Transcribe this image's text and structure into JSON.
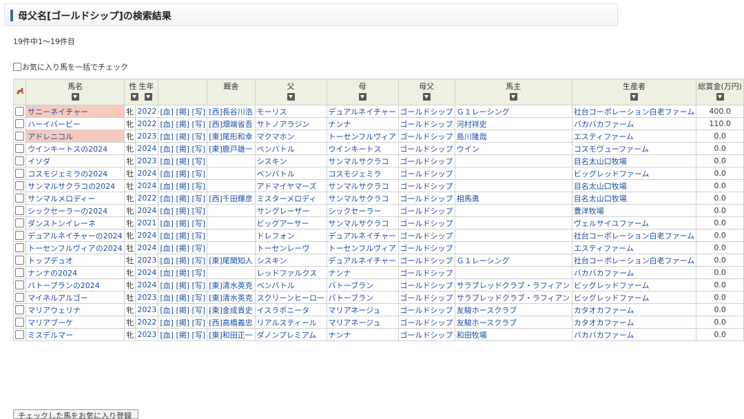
{
  "page": {
    "title": "母父名[ゴールドシップ]の検索結果",
    "count_text": "19件中1〜19件目",
    "check_all_label": "お気に入り馬を一括でチェック",
    "bottom_button_label": "チェックした馬をお気に入り登録",
    "accent_color": "#2c6fb6",
    "highlight_color": "#f5cbbd"
  },
  "table": {
    "headers": {
      "icon": "horse-icon",
      "horse_name": "馬名",
      "sex": "性",
      "birth_year": "生年",
      "stable": "厩舎",
      "sire": "父",
      "dam": "母",
      "dam_sire": "母父",
      "owner": "馬主",
      "breeder": "生産者",
      "earnings": "総賞金(万円)"
    },
    "link_labels": [
      "[血]",
      "[掲]",
      "[写]"
    ],
    "rows": [
      {
        "horse": "サニーネイチャー",
        "hl": true,
        "sex": "牝",
        "year": "2022",
        "stable": "[西]長谷川浩",
        "sire": "モーリス",
        "dam": "デュアルネイチャー",
        "dam_sire": "ゴールドシップ",
        "owner": "Ｇ１レーシング",
        "breeder": "社台コーポレーション白老ファーム",
        "earnings": "400.0"
      },
      {
        "horse": "ハーイバービー",
        "hl": false,
        "sex": "牝",
        "year": "2022",
        "stable": "[西]畑端省吾",
        "sire": "サトノアラジン",
        "dam": "ナンナ",
        "dam_sire": "ゴールドシップ",
        "owner": "河村祥史",
        "breeder": "バカバカファーム",
        "earnings": "110.0"
      },
      {
        "horse": "アドレニコル",
        "hl": true,
        "sex": "牝",
        "year": "2023",
        "stable": "[東]尾形和幸",
        "sire": "マクマホン",
        "dam": "トーセンフルヴィア",
        "dam_sire": "ゴールドシップ",
        "owner": "島川隆哉",
        "breeder": "エスティファーム",
        "earnings": "0.0"
      },
      {
        "horse": "ウインキートスの2024",
        "hl": false,
        "sex": "牝",
        "year": "2024",
        "stable": "[東]鹿戸雄一",
        "sire": "ベンバトル",
        "dam": "ウインキートス",
        "dam_sire": "ゴールドシップ",
        "owner": "ウイン",
        "breeder": "コスモヴューファーム",
        "earnings": "0.0"
      },
      {
        "horse": "イソダ",
        "hl": false,
        "sex": "牝",
        "year": "2023",
        "stable": "",
        "sire": "シスキン",
        "dam": "サンマルサクラコ",
        "dam_sire": "ゴールドシップ",
        "owner": "",
        "breeder": "目名太山口牧場",
        "earnings": "0.0"
      },
      {
        "horse": "コスモジェミラの2024",
        "hl": false,
        "sex": "牡",
        "year": "2024",
        "stable": "",
        "sire": "ベンバトル",
        "dam": "コスモジェミラ",
        "dam_sire": "ゴールドシップ",
        "owner": "",
        "breeder": "ビッグレッドファーム",
        "earnings": "0.0"
      },
      {
        "horse": "サンマルサクラコの2024",
        "hl": false,
        "sex": "牡",
        "year": "2024",
        "stable": "",
        "sire": "アドマイヤマーズ",
        "dam": "サンマルサクラコ",
        "dam_sire": "ゴールドシップ",
        "owner": "",
        "breeder": "目名太山口牧場",
        "earnings": "0.0"
      },
      {
        "horse": "サンマルメロディー",
        "hl": false,
        "sex": "牝",
        "year": "2022",
        "stable": "[西]千田輝彦",
        "sire": "ミスターメロディ",
        "dam": "サンマルサクラコ",
        "dam_sire": "ゴールドシップ",
        "owner": "相馬勇",
        "breeder": "目名太山口牧場",
        "earnings": "0.0"
      },
      {
        "horse": "シックセーラーの2024",
        "hl": false,
        "sex": "牝",
        "year": "2024",
        "stable": "",
        "sire": "サングレーザー",
        "dam": "シックセーラー",
        "dam_sire": "ゴールドシップ",
        "owner": "",
        "breeder": "豊洋牧場",
        "earnings": "0.0"
      },
      {
        "horse": "ダンストンイレーネ",
        "hl": false,
        "sex": "牝",
        "year": "2021",
        "stable": "",
        "sire": "ビッグアーサー",
        "dam": "サンマルサクラコ",
        "dam_sire": "ゴールドシップ",
        "owner": "",
        "breeder": "ヴェルサイユファーム",
        "earnings": "0.0"
      },
      {
        "horse": "デュアルネイチャーの2024",
        "hl": false,
        "sex": "牝",
        "year": "2024",
        "stable": "",
        "sire": "ドレフォン",
        "dam": "デュアルネイチャー",
        "dam_sire": "ゴールドシップ",
        "owner": "",
        "breeder": "社台コーポレーション白老ファーム",
        "earnings": "0.0"
      },
      {
        "horse": "トーセンフルヴィアの2024",
        "hl": false,
        "sex": "牡",
        "year": "2024",
        "stable": "",
        "sire": "トーセンレーヴ",
        "dam": "トーセンフルヴィア",
        "dam_sire": "ゴールドシップ",
        "owner": "",
        "breeder": "エスティファーム",
        "earnings": "0.0"
      },
      {
        "horse": "トップデュオ",
        "hl": false,
        "sex": "牡",
        "year": "2023",
        "stable": "[東]尾関知人",
        "sire": "シスキン",
        "dam": "デュアルネイチャー",
        "dam_sire": "ゴールドシップ",
        "owner": "Ｇ１レーシング",
        "breeder": "社台コーポレーション白老ファーム",
        "earnings": "0.0"
      },
      {
        "horse": "ナンナの2024",
        "hl": false,
        "sex": "牝",
        "year": "2024",
        "stable": "",
        "sire": "レッドファルクス",
        "dam": "ナンナ",
        "dam_sire": "ゴールドシップ",
        "owner": "",
        "breeder": "バカバカファーム",
        "earnings": "0.0"
      },
      {
        "horse": "バトーブランの2024",
        "hl": false,
        "sex": "牝",
        "year": "2024",
        "stable": "[東]清水英克",
        "sire": "ベンバトル",
        "dam": "バトーブラン",
        "dam_sire": "ゴールドシップ",
        "owner": "サラブレッドクラブ・ラフィアン",
        "breeder": "ビッグレッドファーム",
        "earnings": "0.0"
      },
      {
        "horse": "マイネルアルゴー",
        "hl": false,
        "sex": "牡",
        "year": "2023",
        "stable": "[東]清水英克",
        "sire": "スクリーンヒーロー",
        "dam": "バトーブラン",
        "dam_sire": "ゴールドシップ",
        "owner": "サラブレッドクラブ・ラフィアン",
        "breeder": "ビッグレッドファーム",
        "earnings": "0.0"
      },
      {
        "horse": "マリアウェリナ",
        "hl": false,
        "sex": "牝",
        "year": "2023",
        "stable": "[東]金成貴史",
        "sire": "イスラボニータ",
        "dam": "マリアネージュ",
        "dam_sire": "ゴールドシップ",
        "owner": "友駿ホースクラブ",
        "breeder": "カタオカファーム",
        "earnings": "0.0"
      },
      {
        "horse": "マリアブーケ",
        "hl": false,
        "sex": "牝",
        "year": "2022",
        "stable": "[西]高橋義忠",
        "sire": "リアルスティール",
        "dam": "マリアネージュ",
        "dam_sire": "ゴールドシップ",
        "owner": "友駿ホースクラブ",
        "breeder": "カタオカファーム",
        "earnings": "0.0"
      },
      {
        "horse": "ミスデルマー",
        "hl": false,
        "sex": "牝",
        "year": "2023",
        "stable": "[東]和田正一",
        "sire": "ダノンプレミアム",
        "dam": "ナンナ",
        "dam_sire": "ゴールドシップ",
        "owner": "和田牧場",
        "breeder": "バカバカファーム",
        "earnings": "0.0"
      }
    ]
  }
}
